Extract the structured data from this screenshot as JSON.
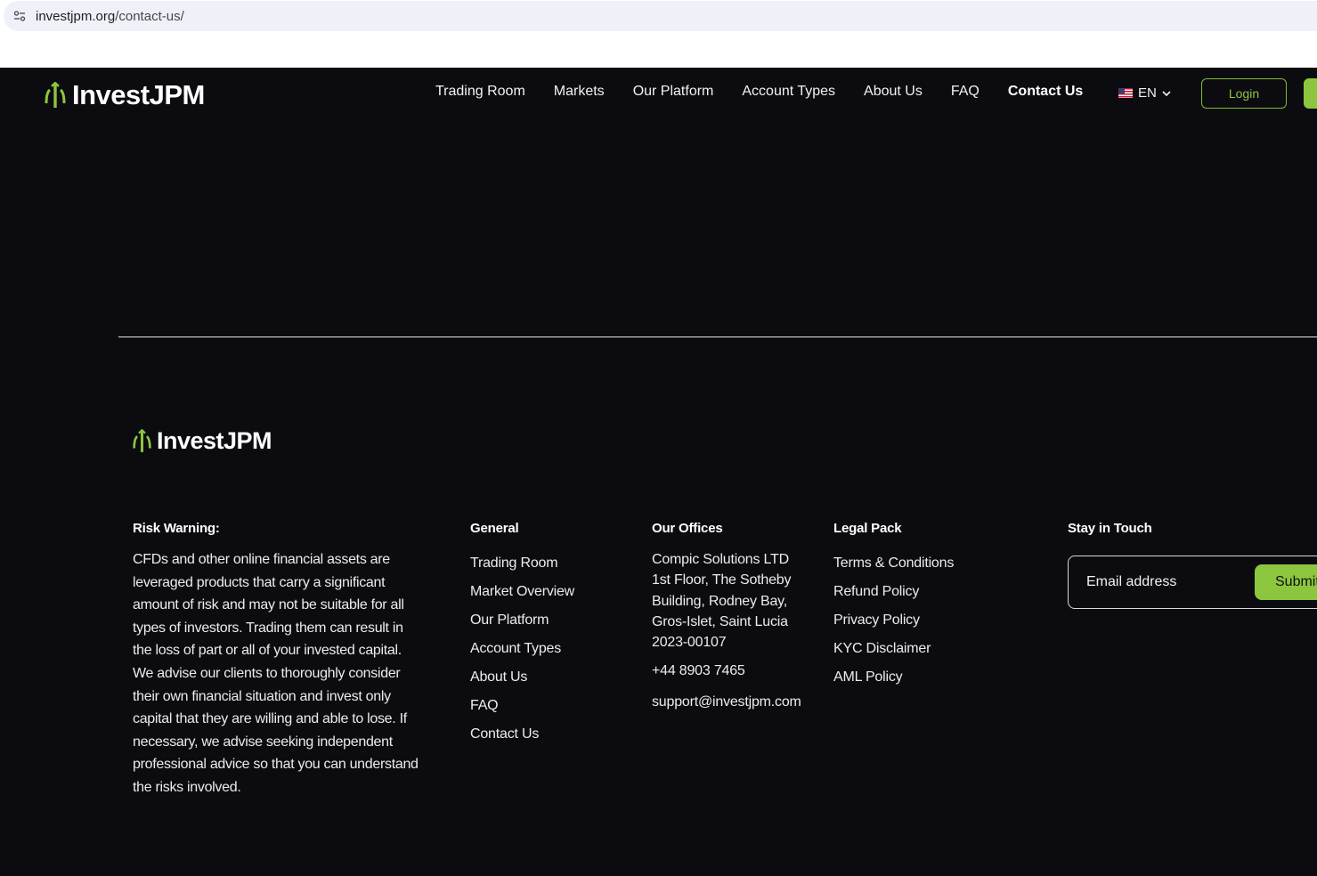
{
  "browser": {
    "url_host": "investjpm.org",
    "url_path": "/contact-us/"
  },
  "brand": {
    "name": "InvestJPM",
    "accent": "#8cc63f",
    "background": "#0c0c10"
  },
  "nav": {
    "items": [
      {
        "label": "Trading Room",
        "active": false
      },
      {
        "label": "Markets",
        "active": false
      },
      {
        "label": "Our Platform",
        "active": false
      },
      {
        "label": "Account Types",
        "active": false
      },
      {
        "label": "About Us",
        "active": false
      },
      {
        "label": "FAQ",
        "active": false
      },
      {
        "label": "Contact Us",
        "active": true
      }
    ],
    "language": "EN",
    "login_label": "Login"
  },
  "footer": {
    "risk": {
      "title": "Risk Warning:",
      "text": "CFDs and other online financial assets are leveraged products that carry a significant amount of risk and may not be suitable for all types of investors. Trading them can result in the loss of part or all of your invested capital. We advise our clients to thoroughly consider their own financial situation and invest only capital that they are willing and able to lose. If necessary, we advise seeking independent professional advice so that you can understand the risks involved."
    },
    "general": {
      "title": "General",
      "links": [
        "Trading Room",
        "Market Overview",
        "Our Platform",
        "Account Types",
        "About Us",
        "FAQ",
        "Contact Us"
      ]
    },
    "offices": {
      "title": "Our Offices",
      "company": "Compic Solutions LTD",
      "address": "1st Floor, The Sotheby Building, Rodney Bay, Gros-Islet, Saint Lucia",
      "registration": "2023-00107",
      "phone": "+44 8903 7465",
      "email": "support@investjpm.com"
    },
    "legal": {
      "title": "Legal Pack",
      "links": [
        "Terms & Conditions",
        "Refund Policy",
        "Privacy Policy",
        "KYC Disclaimer",
        "AML Policy"
      ]
    },
    "newsletter": {
      "title": "Stay in Touch",
      "placeholder": "Email address",
      "submit_label": "Submit"
    }
  }
}
